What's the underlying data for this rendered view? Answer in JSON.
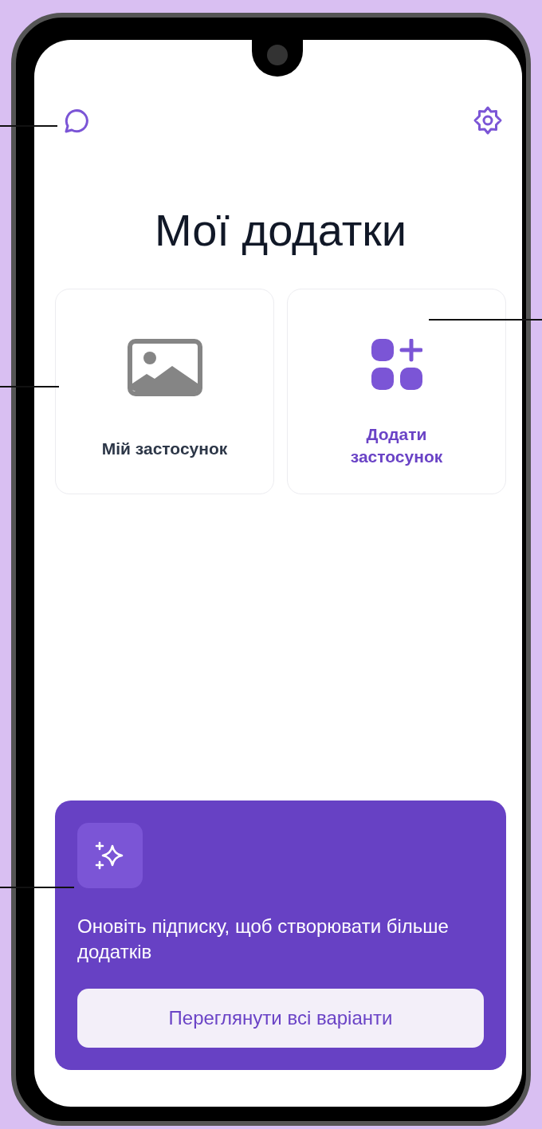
{
  "header": {
    "title": "Мої додатки"
  },
  "cards": [
    {
      "kind": "app",
      "label": "Мій застосунок"
    },
    {
      "kind": "add",
      "label": "Додати застосунок"
    }
  ],
  "banner": {
    "text": "Оновіть підписку, щоб створювати більше додатків",
    "button": "Переглянути всі варіанти"
  }
}
